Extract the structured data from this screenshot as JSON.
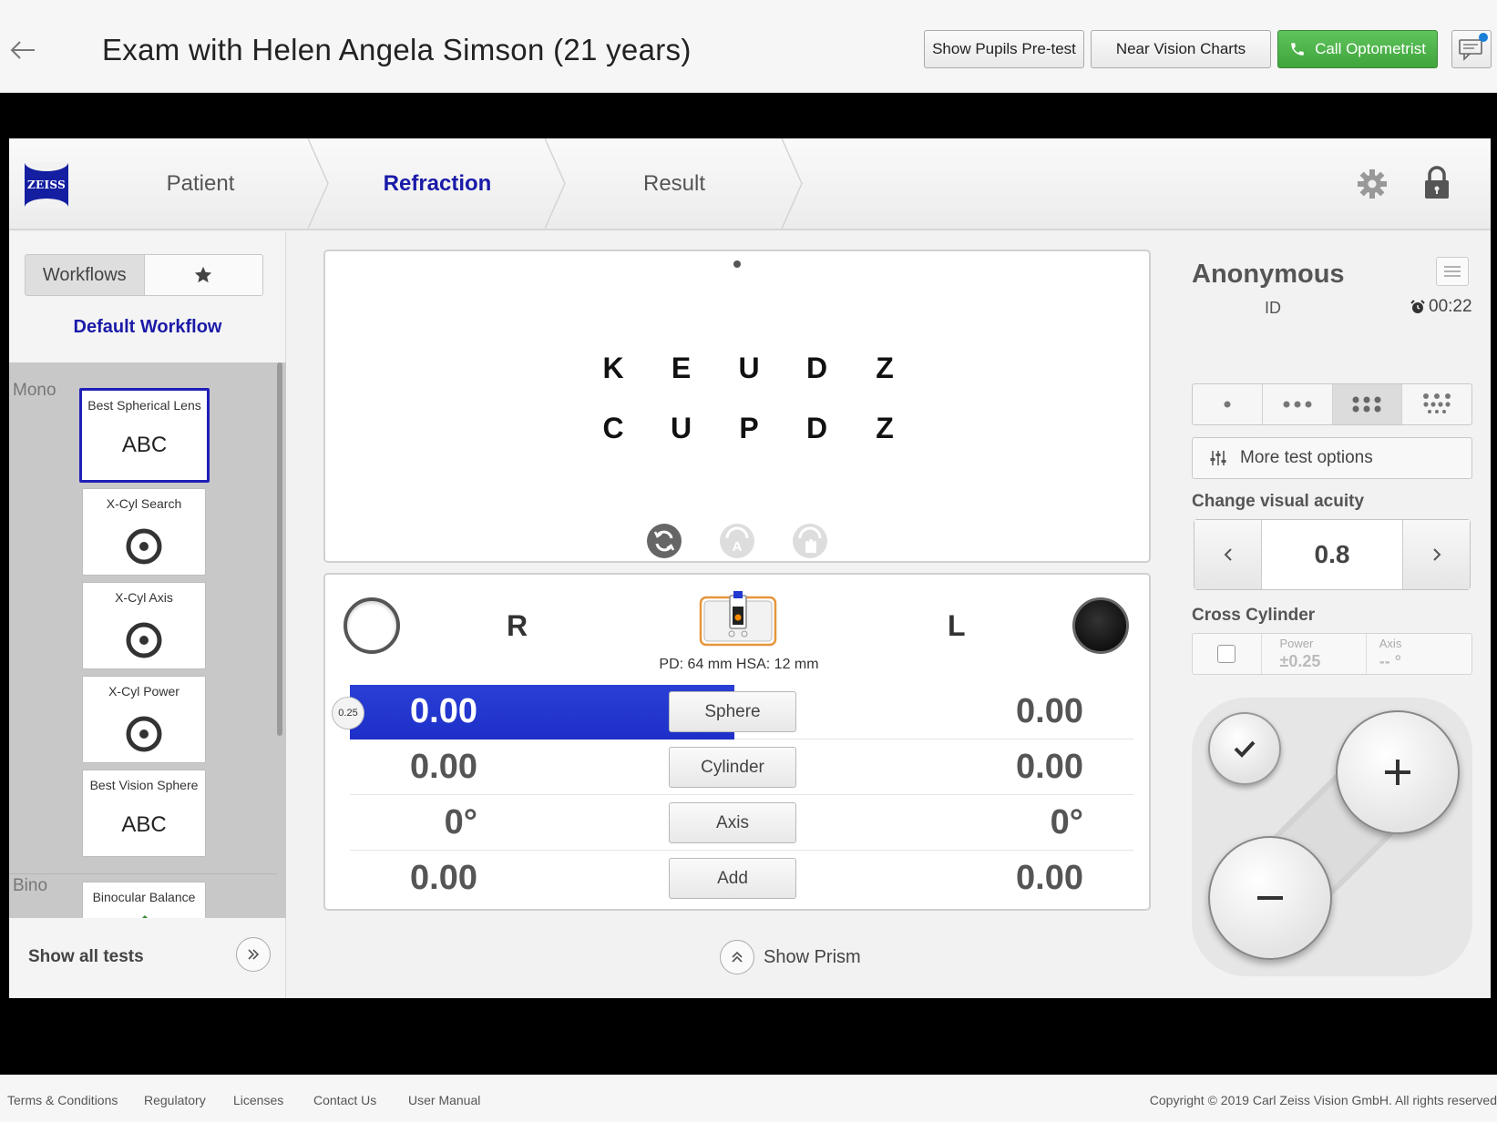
{
  "header": {
    "title": "Exam with Helen Angela Simson (21 years)",
    "buttons": {
      "pupils": "Show Pupils Pre-test",
      "near": "Near Vision Charts",
      "call": "Call Optometrist"
    },
    "icons": {
      "back": "back-arrow-icon",
      "phone": "phone-icon",
      "messages": "chat-icon"
    },
    "colors": {
      "call_green": "#4cb449",
      "notification": "#1a7fd6"
    }
  },
  "app": {
    "logo": "ZEISS",
    "steps": [
      "Patient",
      "Refraction",
      "Result"
    ],
    "active_step": "Refraction",
    "accent": "#1a1aa8"
  },
  "workflow": {
    "tabs": {
      "workflows": "Workflows",
      "favorites_icon": "star-icon"
    },
    "title": "Default Workflow",
    "groups": {
      "mono": "Mono",
      "bino": "Bino"
    },
    "tests": [
      {
        "name": "Best Spherical Lens",
        "symbol": "ABC",
        "selected": true
      },
      {
        "name": "X-Cyl Search",
        "symbol": "target-icon"
      },
      {
        "name": "X-Cyl Axis",
        "symbol": "target-icon"
      },
      {
        "name": "X-Cyl Power",
        "symbol": "target-icon"
      },
      {
        "name": "Best Vision Sphere",
        "symbol": "ABC"
      },
      {
        "name": "Binocular Balance",
        "symbol": ""
      }
    ],
    "show_all": "Show all tests"
  },
  "chart": {
    "row1": [
      "K",
      "E",
      "U",
      "D",
      "Z"
    ],
    "row2": [
      "C",
      "U",
      "P",
      "D",
      "Z"
    ],
    "controls": [
      "refresh-icon",
      "auto-icon",
      "manual-icon"
    ]
  },
  "refraction": {
    "eye_right": "R",
    "eye_left": "L",
    "pd_hsa": "PD: 64 mm HSA: 12 mm",
    "step_size": "0.25",
    "rows": [
      {
        "label": "Sphere",
        "right": "0.00",
        "left": "0.00",
        "selected": true
      },
      {
        "label": "Cylinder",
        "right": "0.00",
        "left": "0.00"
      },
      {
        "label": "Axis",
        "right": "0°",
        "left": "0°"
      },
      {
        "label": "Add",
        "right": "0.00",
        "left": "0.00"
      }
    ],
    "show_prism": "Show Prism",
    "selection_color": "#2238d0"
  },
  "patient": {
    "name": "Anonymous",
    "id_label": "ID",
    "timer": "00:22"
  },
  "controls": {
    "optotype_modes": [
      "single-dot-icon",
      "three-dots-icon",
      "six-dots-icon",
      "nine-dots-icon"
    ],
    "active_mode_index": 2,
    "more_options": "More test options",
    "visual_acuity_label": "Change visual acuity",
    "visual_acuity_value": "0.8",
    "cross_cylinder_label": "Cross Cylinder",
    "xcyl_power_label": "Power",
    "xcyl_power_value": "±0.25",
    "xcyl_axis_label": "Axis",
    "xcyl_axis_value": "-- °"
  },
  "footer": {
    "links": [
      "Terms & Conditions",
      "Regulatory",
      "Licenses",
      "Contact Us",
      "User Manual"
    ],
    "copyright": "Copyright © 2019 Carl Zeiss Vision GmbH. All rights reserved"
  }
}
